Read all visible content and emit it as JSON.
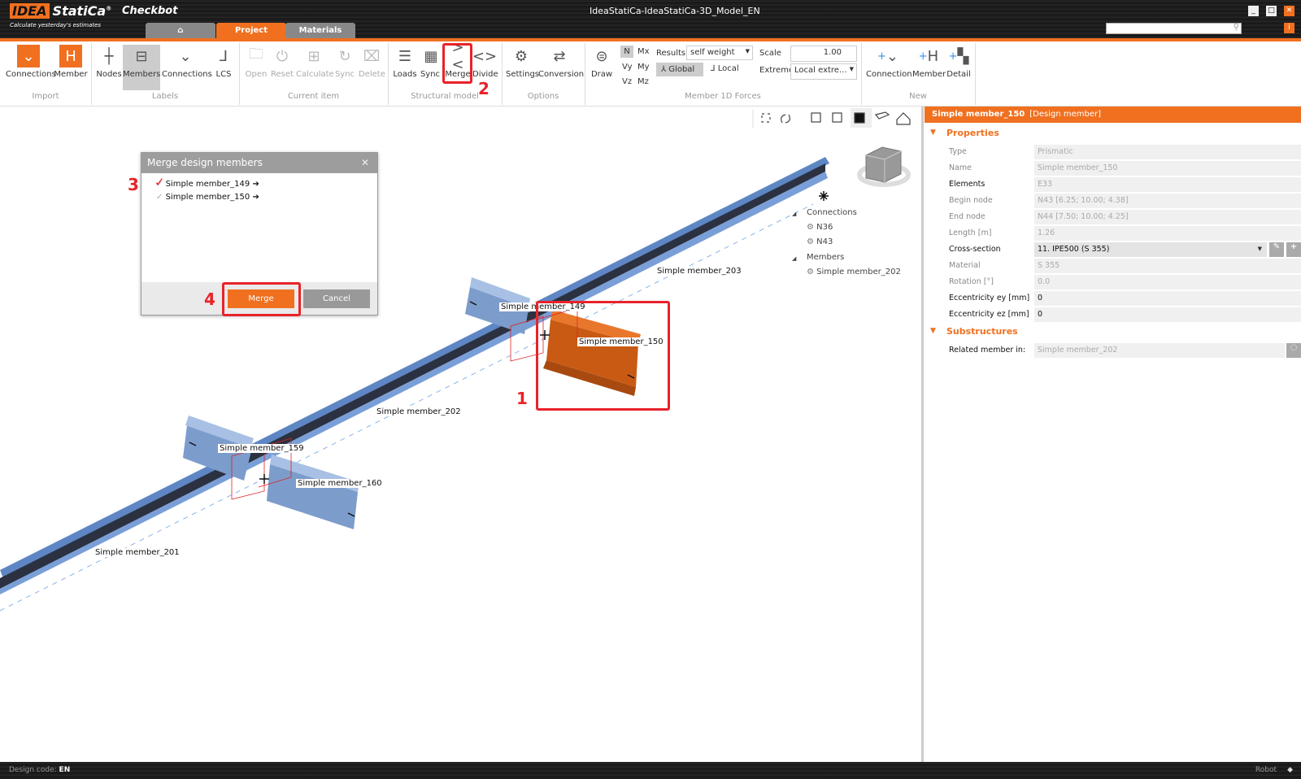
{
  "app": {
    "logo": "IDEA StatiCa",
    "product": "Checkbot",
    "slogan": "Calculate yesterday's estimates",
    "window_title": "IdeaStatiCa-IdeaStatiCa-3D_Model_EN",
    "brand_color": "#f07020"
  },
  "tabs": [
    {
      "label": "",
      "icon": "home-icon"
    },
    {
      "label": "Project",
      "active": true
    },
    {
      "label": "Materials"
    }
  ],
  "ribbon": {
    "import": {
      "label": "Import",
      "items": [
        "Connections",
        "Member"
      ]
    },
    "labels": {
      "label": "Labels",
      "items": [
        "Nodes",
        "Members",
        "Connections",
        "LCS"
      ],
      "selected": "Members"
    },
    "current_item": {
      "label": "Current item",
      "items": [
        "Open",
        "Reset",
        "Calculate",
        "Sync",
        "Delete"
      ]
    },
    "structural_model": {
      "label": "Structural model",
      "items": [
        "Loads",
        "Sync",
        "Merge",
        "Divide"
      ]
    },
    "options": {
      "label": "Options",
      "items": [
        "Settings",
        "Conversion"
      ]
    },
    "forces": {
      "label": "Member 1D Forces",
      "draw": "Draw",
      "components": [
        "N",
        "Mx",
        "Vy",
        "My",
        "Vz",
        "Mz"
      ],
      "selected_component": "N",
      "results_label": "Results",
      "results_value": "self weight",
      "global": "Global",
      "local": "Local",
      "scale_label": "Scale",
      "scale_value": "1.00",
      "extreme_label": "Extreme",
      "extreme_value": "Local extre..."
    },
    "new": {
      "label": "New",
      "items": [
        "Connection",
        "Member",
        "Detail"
      ]
    }
  },
  "viewport": {
    "labels": {
      "m149": "Simple member_149",
      "m150": "Simple member_150",
      "m159": "Simple member_159",
      "m160": "Simple member_160",
      "m201": "Simple member_201",
      "m202": "Simple member_202",
      "m203": "Simple member_203"
    },
    "tree": {
      "connections": "Connections",
      "conn_items": [
        "N36",
        "N43"
      ],
      "members": "Members",
      "member_items": [
        "Simple member_202"
      ]
    }
  },
  "dialog": {
    "title": "Merge design members",
    "items": [
      "Simple member_149",
      "Simple member_150"
    ],
    "merge": "Merge",
    "cancel": "Cancel"
  },
  "annotations": [
    "1",
    "2",
    "3",
    "4"
  ],
  "panel": {
    "header": "Simple member_150",
    "header_type": "[Design member]",
    "properties_title": "Properties",
    "rows": [
      {
        "label": "Type",
        "value": "Prismatic"
      },
      {
        "label": "Name",
        "value": "Simple member_150"
      },
      {
        "label": "Elements",
        "value": "E33"
      },
      {
        "label": "Begin node",
        "value": "N43 [6.25; 10.00; 4.38]"
      },
      {
        "label": "End node",
        "value": "N44 [7.50; 10.00; 4.25]"
      },
      {
        "label": "Length [m]",
        "value": "1.26"
      },
      {
        "label": "Cross-section",
        "value": "11. IPE500 (S 355)"
      },
      {
        "label": "Material",
        "value": "S 355"
      },
      {
        "label": "Rotation [°]",
        "value": "0.0"
      },
      {
        "label": "Eccentricity ey [mm]",
        "value": "0"
      },
      {
        "label": "Eccentricity ez [mm]",
        "value": "0"
      }
    ],
    "substructures_title": "Substructures",
    "related_label": "Related member in:",
    "related_value": "Simple member_202"
  },
  "status": {
    "design_code_label": "Design code:",
    "design_code": "EN",
    "robot": "Robot"
  }
}
